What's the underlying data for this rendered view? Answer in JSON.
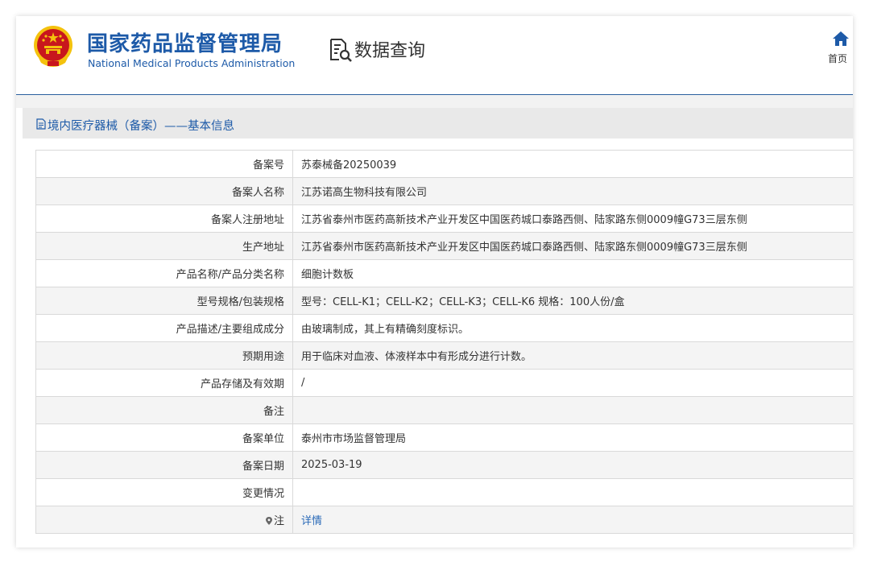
{
  "header": {
    "brand_cn": "国家药品监督管理局",
    "brand_en": "National Medical Products Administration",
    "query_title": "数据查询",
    "home_label": "首页"
  },
  "section": {
    "title": "境内医疗器械（备案）——基本信息"
  },
  "rows": [
    {
      "label": "备案号",
      "value": "苏泰械备20250039"
    },
    {
      "label": "备案人名称",
      "value": "江苏诺高生物科技有限公司"
    },
    {
      "label": "备案人注册地址",
      "value": "江苏省泰州市医药高新技术产业开发区中国医药城口泰路西侧、陆家路东侧0009幢G73三层东侧"
    },
    {
      "label": "生产地址",
      "value": "江苏省泰州市医药高新技术产业开发区中国医药城口泰路西侧、陆家路东侧0009幢G73三层东侧"
    },
    {
      "label": "产品名称/产品分类名称",
      "value": "细胞计数板"
    },
    {
      "label": "型号规格/包装规格",
      "value": "型号：CELL-K1；CELL-K2；CELL-K3；CELL-K6 规格：100人份/盒"
    },
    {
      "label": "产品描述/主要组成成分",
      "value": "由玻璃制成，其上有精确刻度标识。"
    },
    {
      "label": "预期用途",
      "value": "用于临床对血液、体液样本中有形成分进行计数。"
    },
    {
      "label": "产品存储及有效期",
      "value": "/"
    },
    {
      "label": "备注",
      "value": ""
    },
    {
      "label": "备案单位",
      "value": "泰州市市场监督管理局"
    },
    {
      "label": "备案日期",
      "value": "2025-03-19"
    },
    {
      "label": "变更情况",
      "value": ""
    },
    {
      "label": "注",
      "value": "详情"
    }
  ],
  "colors": {
    "brand_blue": "#1d5aa8",
    "link_blue": "#2a6ab8",
    "emblem_red": "#c8161d",
    "emblem_gold": "#f4c20d"
  },
  "icons": {
    "emblem": "national-emblem-icon",
    "query": "document-search-icon",
    "home": "home-icon",
    "section": "document-icon",
    "note": "pin-icon"
  }
}
